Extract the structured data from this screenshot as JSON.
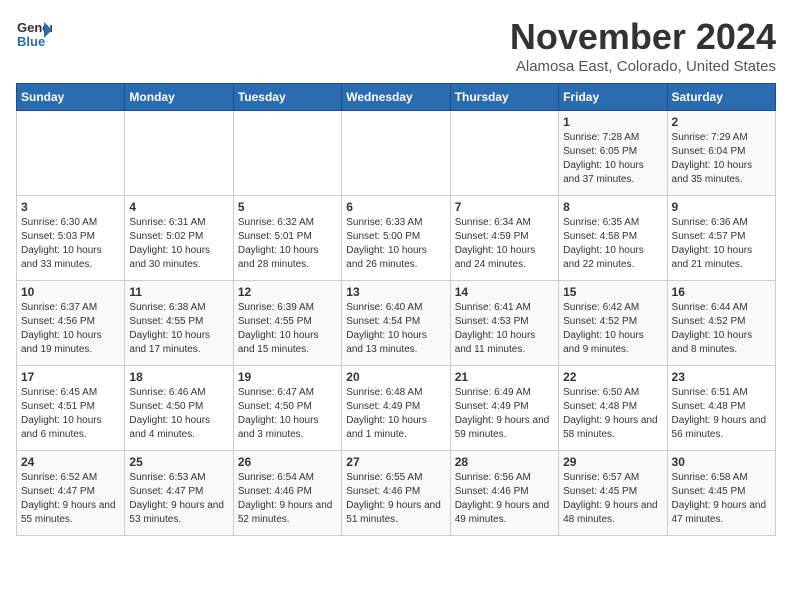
{
  "logo": {
    "general": "General",
    "blue": "Blue"
  },
  "header": {
    "month": "November 2024",
    "location": "Alamosa East, Colorado, United States"
  },
  "days_of_week": [
    "Sunday",
    "Monday",
    "Tuesday",
    "Wednesday",
    "Thursday",
    "Friday",
    "Saturday"
  ],
  "weeks": [
    [
      {
        "day": "",
        "info": ""
      },
      {
        "day": "",
        "info": ""
      },
      {
        "day": "",
        "info": ""
      },
      {
        "day": "",
        "info": ""
      },
      {
        "day": "",
        "info": ""
      },
      {
        "day": "1",
        "info": "Sunrise: 7:28 AM\nSunset: 6:05 PM\nDaylight: 10 hours and 37 minutes."
      },
      {
        "day": "2",
        "info": "Sunrise: 7:29 AM\nSunset: 6:04 PM\nDaylight: 10 hours and 35 minutes."
      }
    ],
    [
      {
        "day": "3",
        "info": "Sunrise: 6:30 AM\nSunset: 5:03 PM\nDaylight: 10 hours and 33 minutes."
      },
      {
        "day": "4",
        "info": "Sunrise: 6:31 AM\nSunset: 5:02 PM\nDaylight: 10 hours and 30 minutes."
      },
      {
        "day": "5",
        "info": "Sunrise: 6:32 AM\nSunset: 5:01 PM\nDaylight: 10 hours and 28 minutes."
      },
      {
        "day": "6",
        "info": "Sunrise: 6:33 AM\nSunset: 5:00 PM\nDaylight: 10 hours and 26 minutes."
      },
      {
        "day": "7",
        "info": "Sunrise: 6:34 AM\nSunset: 4:59 PM\nDaylight: 10 hours and 24 minutes."
      },
      {
        "day": "8",
        "info": "Sunrise: 6:35 AM\nSunset: 4:58 PM\nDaylight: 10 hours and 22 minutes."
      },
      {
        "day": "9",
        "info": "Sunrise: 6:36 AM\nSunset: 4:57 PM\nDaylight: 10 hours and 21 minutes."
      }
    ],
    [
      {
        "day": "10",
        "info": "Sunrise: 6:37 AM\nSunset: 4:56 PM\nDaylight: 10 hours and 19 minutes."
      },
      {
        "day": "11",
        "info": "Sunrise: 6:38 AM\nSunset: 4:55 PM\nDaylight: 10 hours and 17 minutes."
      },
      {
        "day": "12",
        "info": "Sunrise: 6:39 AM\nSunset: 4:55 PM\nDaylight: 10 hours and 15 minutes."
      },
      {
        "day": "13",
        "info": "Sunrise: 6:40 AM\nSunset: 4:54 PM\nDaylight: 10 hours and 13 minutes."
      },
      {
        "day": "14",
        "info": "Sunrise: 6:41 AM\nSunset: 4:53 PM\nDaylight: 10 hours and 11 minutes."
      },
      {
        "day": "15",
        "info": "Sunrise: 6:42 AM\nSunset: 4:52 PM\nDaylight: 10 hours and 9 minutes."
      },
      {
        "day": "16",
        "info": "Sunrise: 6:44 AM\nSunset: 4:52 PM\nDaylight: 10 hours and 8 minutes."
      }
    ],
    [
      {
        "day": "17",
        "info": "Sunrise: 6:45 AM\nSunset: 4:51 PM\nDaylight: 10 hours and 6 minutes."
      },
      {
        "day": "18",
        "info": "Sunrise: 6:46 AM\nSunset: 4:50 PM\nDaylight: 10 hours and 4 minutes."
      },
      {
        "day": "19",
        "info": "Sunrise: 6:47 AM\nSunset: 4:50 PM\nDaylight: 10 hours and 3 minutes."
      },
      {
        "day": "20",
        "info": "Sunrise: 6:48 AM\nSunset: 4:49 PM\nDaylight: 10 hours and 1 minute."
      },
      {
        "day": "21",
        "info": "Sunrise: 6:49 AM\nSunset: 4:49 PM\nDaylight: 9 hours and 59 minutes."
      },
      {
        "day": "22",
        "info": "Sunrise: 6:50 AM\nSunset: 4:48 PM\nDaylight: 9 hours and 58 minutes."
      },
      {
        "day": "23",
        "info": "Sunrise: 6:51 AM\nSunset: 4:48 PM\nDaylight: 9 hours and 56 minutes."
      }
    ],
    [
      {
        "day": "24",
        "info": "Sunrise: 6:52 AM\nSunset: 4:47 PM\nDaylight: 9 hours and 55 minutes."
      },
      {
        "day": "25",
        "info": "Sunrise: 6:53 AM\nSunset: 4:47 PM\nDaylight: 9 hours and 53 minutes."
      },
      {
        "day": "26",
        "info": "Sunrise: 6:54 AM\nSunset: 4:46 PM\nDaylight: 9 hours and 52 minutes."
      },
      {
        "day": "27",
        "info": "Sunrise: 6:55 AM\nSunset: 4:46 PM\nDaylight: 9 hours and 51 minutes."
      },
      {
        "day": "28",
        "info": "Sunrise: 6:56 AM\nSunset: 4:46 PM\nDaylight: 9 hours and 49 minutes."
      },
      {
        "day": "29",
        "info": "Sunrise: 6:57 AM\nSunset: 4:45 PM\nDaylight: 9 hours and 48 minutes."
      },
      {
        "day": "30",
        "info": "Sunrise: 6:58 AM\nSunset: 4:45 PM\nDaylight: 9 hours and 47 minutes."
      }
    ]
  ]
}
